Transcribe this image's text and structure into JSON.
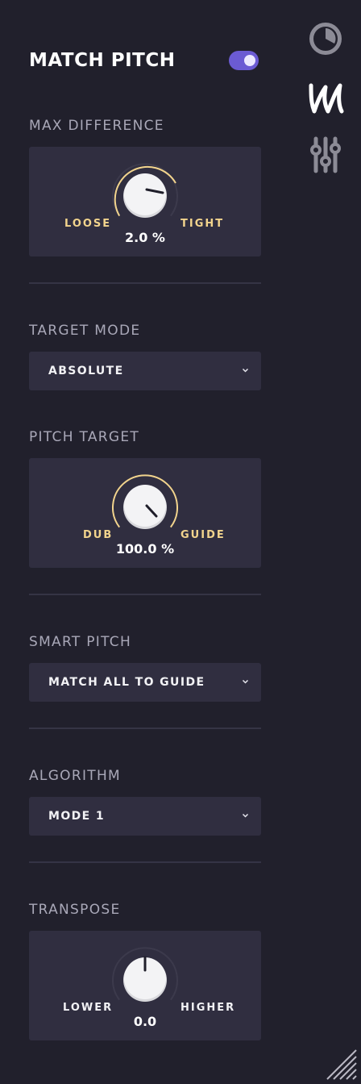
{
  "header": {
    "title": "MATCH PITCH",
    "enabled": true
  },
  "side_toolbar": [
    "clock-icon",
    "m-logo-icon",
    "sliders-icon"
  ],
  "sections": {
    "max_difference": {
      "label": "MAX DIFFERENCE",
      "left_label": "LOOSE",
      "right_label": "TIGHT",
      "value": "2.0 %"
    },
    "target_mode": {
      "label": "TARGET MODE",
      "selected": "ABSOLUTE"
    },
    "pitch_target": {
      "label": "PITCH TARGET",
      "left_label": "DUB",
      "right_label": "GUIDE",
      "value": "100.0 %"
    },
    "smart_pitch": {
      "label": "SMART PITCH",
      "selected": "MATCH ALL TO GUIDE"
    },
    "algorithm": {
      "label": "ALGORITHM",
      "selected": "MODE 1"
    },
    "transpose": {
      "label": "TRANSPOSE",
      "left_label": "LOWER",
      "right_label": "HIGHER",
      "value": "0.0"
    }
  },
  "colors": {
    "background": "#21202c",
    "panel": "#302e40",
    "accent_toggle": "#6b5bd3",
    "knob_arc": "#f2d48d",
    "label": "#a9a8b8"
  }
}
